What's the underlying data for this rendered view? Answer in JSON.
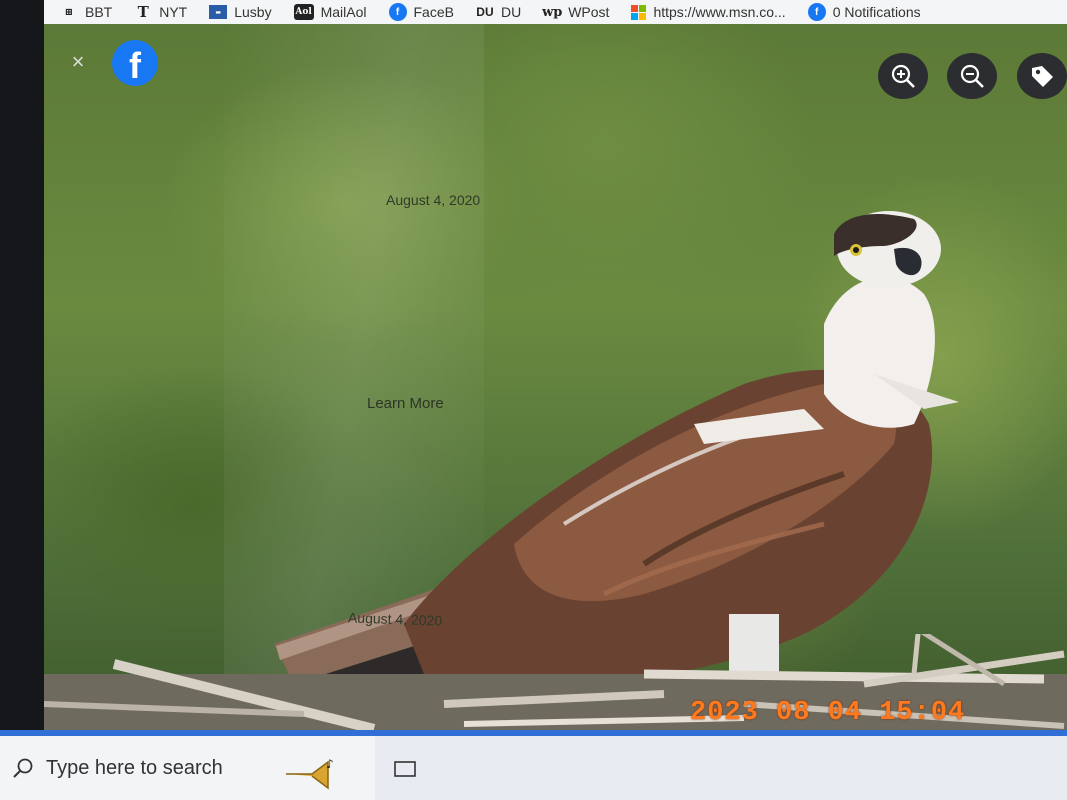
{
  "bookmarks": [
    {
      "label": "BBT",
      "icon": "bbt-icon"
    },
    {
      "label": "NYT",
      "icon": "nyt-icon"
    },
    {
      "label": "Lusby",
      "icon": "lusby-icon"
    },
    {
      "label": "MailAol",
      "icon": "aol-icon"
    },
    {
      "label": "FaceB",
      "icon": "facebook-icon"
    },
    {
      "label": "DU",
      "icon": "du-icon"
    },
    {
      "label": "WPost",
      "icon": "wpost-icon"
    },
    {
      "label": "https://www.msn.co...",
      "icon": "microsoft-icon"
    },
    {
      "label": "0 Notifications",
      "icon": "facebook-icon"
    }
  ],
  "viewer": {
    "close_glyph": "×",
    "brand_glyph": "f",
    "caption_top": "August 4, 2020",
    "learn_more": "Learn More",
    "caption_bottom": "August 4, 2020",
    "tools": [
      "zoom-in",
      "zoom-out",
      "tag"
    ]
  },
  "camera_stamp": "2023 08 04  15:04",
  "taskbar": {
    "search_placeholder": "Type here to search"
  },
  "colors": {
    "facebook_blue": "#1877f2",
    "taskbar_accent": "#2f6fd6",
    "stamp_orange": "#ff7a1f"
  }
}
